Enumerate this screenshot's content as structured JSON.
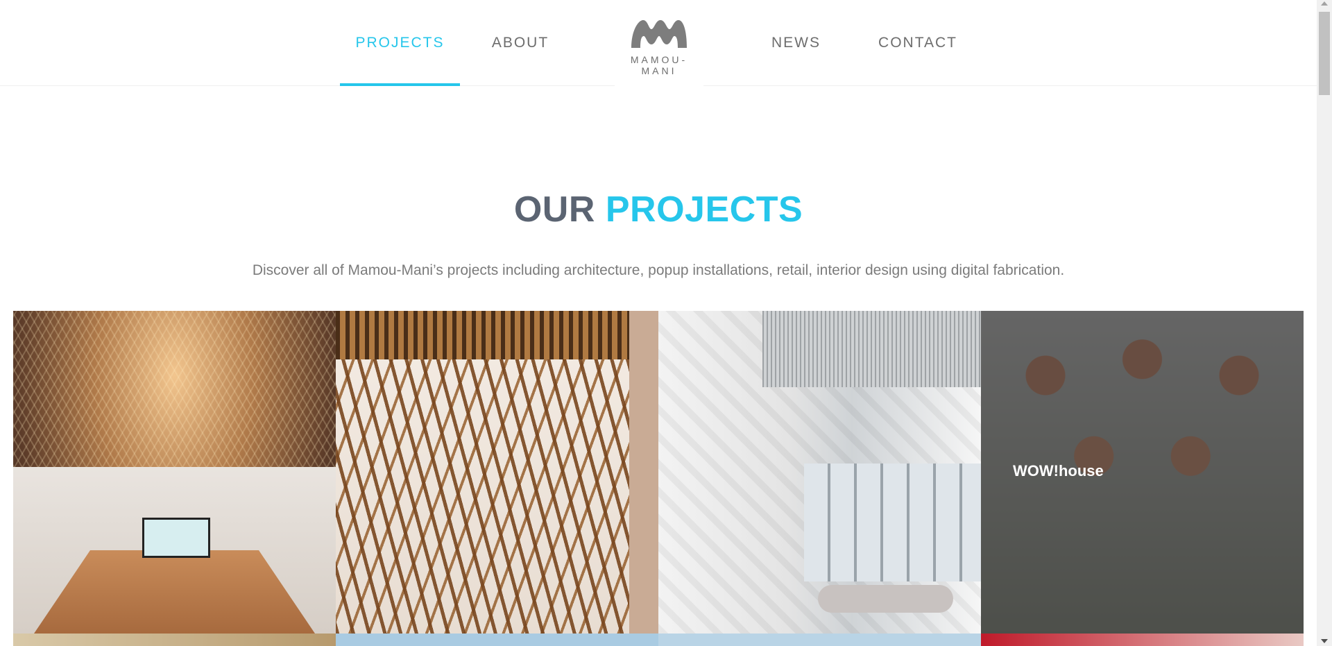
{
  "nav": {
    "left": [
      {
        "label": "PROJECTS",
        "active": true
      },
      {
        "label": "ABOUT",
        "active": false
      }
    ],
    "right": [
      {
        "label": "NEWS",
        "active": false
      },
      {
        "label": "CONTACT",
        "active": false
      }
    ],
    "logo_text": "MAMOU-MANI"
  },
  "heading": {
    "part1": "OUR",
    "part2": "PROJECTS"
  },
  "subtitle": "Discover all of Mamou-Mani’s projects including architecture, popup installations, retail, interior design using digital fabrication.",
  "projects": [
    {
      "title": ""
    },
    {
      "title": ""
    },
    {
      "title": ""
    },
    {
      "title": "WOW!house"
    }
  ],
  "colors": {
    "accent": "#26c6eb",
    "heading_gray": "#5b6472",
    "nav_text": "#6d6d6d"
  }
}
